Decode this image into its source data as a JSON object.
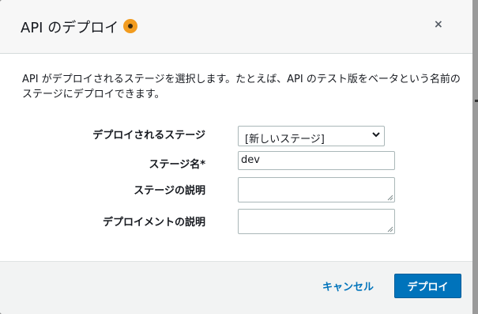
{
  "dialog": {
    "title": "API のデプロイ",
    "info_icon": "info-circle-icon",
    "close_icon": "close-icon",
    "close_label": "×",
    "description": "API がデプロイされるステージを選択します。たとえば、API のテスト版をベータという名前のステージにデプロイできます。"
  },
  "form": {
    "stage_label": "デプロイされるステージ",
    "stage_selected": "[新しいステージ]",
    "stage_name_label": "ステージ名*",
    "stage_name_value": "dev",
    "stage_desc_label": "ステージの説明",
    "stage_desc_value": "",
    "deploy_desc_label": "デプロイメントの説明",
    "deploy_desc_value": ""
  },
  "footer": {
    "cancel_label": "キャンセル",
    "deploy_label": "デプロイ"
  },
  "colors": {
    "accent": "#0073bb",
    "info": "#f29c1f",
    "footer_bg": "#f2f3f3",
    "header_bg": "#f7f7f7"
  }
}
